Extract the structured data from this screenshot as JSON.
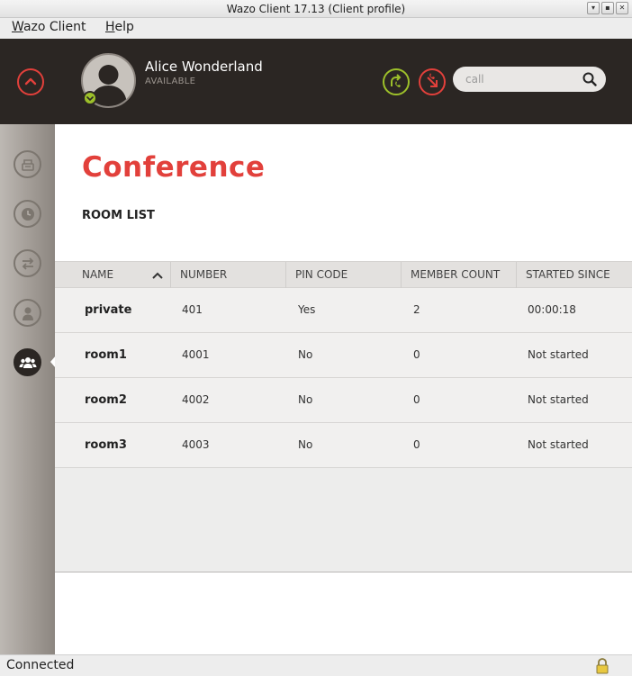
{
  "window": {
    "title": "Wazo Client 17.13 (Client profile)",
    "buttons": [
      "▾",
      "▪",
      "✕"
    ]
  },
  "menu": {
    "items": [
      {
        "label": "Wazo Client",
        "mnemonic": "W"
      },
      {
        "label": "Help",
        "mnemonic": "H"
      }
    ]
  },
  "header": {
    "user_name": "Alice Wonderland",
    "user_status": "AVAILABLE",
    "search_placeholder": "call",
    "colors": {
      "accent": "#e2403b",
      "available": "#9dc02a",
      "background": "#2b2623"
    }
  },
  "sidebar": {
    "items": [
      {
        "icon": "phone-icon",
        "active": false
      },
      {
        "icon": "clock-icon",
        "active": false
      },
      {
        "icon": "transfer-icon",
        "active": false
      },
      {
        "icon": "person-icon",
        "active": false
      },
      {
        "icon": "group-icon",
        "active": true
      }
    ]
  },
  "page": {
    "title": "Conference",
    "section": "ROOM LIST"
  },
  "table": {
    "columns": [
      "NAME",
      "NUMBER",
      "PIN CODE",
      "MEMBER COUNT",
      "STARTED SINCE"
    ],
    "sort_column": "NAME",
    "sort_direction": "ascending",
    "rows": [
      {
        "name": "private",
        "number": "401",
        "pin": "Yes",
        "members": "2",
        "started": "00:00:18"
      },
      {
        "name": "room1",
        "number": "4001",
        "pin": "No",
        "members": "0",
        "started": "Not started"
      },
      {
        "name": "room2",
        "number": "4002",
        "pin": "No",
        "members": "0",
        "started": "Not started"
      },
      {
        "name": "room3",
        "number": "4003",
        "pin": "No",
        "members": "0",
        "started": "Not started"
      }
    ]
  },
  "statusbar": {
    "text": "Connected",
    "icon": "lock-icon"
  }
}
